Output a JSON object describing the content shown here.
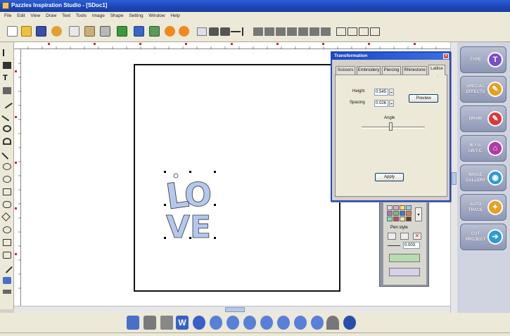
{
  "titlebar": {
    "title": "Pazzles Inspiration Studio - [SDoc1]"
  },
  "menu": [
    "File",
    "Edit",
    "View",
    "Draw",
    "Text",
    "Tools",
    "Image",
    "Shape",
    "Setting",
    "Window",
    "Help"
  ],
  "dialog": {
    "title": "Transformation",
    "tabs": [
      "Scissors",
      "Embroidery",
      "Piercing",
      "Rhinestone",
      "Lattice"
    ],
    "selected_tab": "Lattice",
    "height_label": "Height",
    "height_value": "0.545",
    "spacing_label": "Spacing",
    "spacing_value": "0.026",
    "angle_label": "Angle",
    "angle_slider_fraction": 0.45,
    "preview_label": "Preview",
    "apply_label": "Apply"
  },
  "side_buttons": [
    {
      "label": "TYPE",
      "icon": "type-icon"
    },
    {
      "label": "SPECIAL EFFECTS",
      "icon": "pencil-icon"
    },
    {
      "label": "DRAW",
      "icon": "draw-icon"
    },
    {
      "label": "W.Y.S. I.W.Y.C.",
      "icon": "house-icon"
    },
    {
      "label": "IMAGE GALLERY",
      "icon": "eye-icon"
    },
    {
      "label": "AUTO TRACE",
      "icon": "wand-icon"
    },
    {
      "label": "CUT PROJECT",
      "icon": "cut-icon"
    }
  ],
  "pen_panel": {
    "label": "Pen style",
    "width_value": "0.003"
  },
  "canvas": {
    "artwork_text": "LOVE",
    "artwork_color": "#b3c8ef"
  },
  "colors": {
    "titlebar": "#1c47b8",
    "dialog_border": "#2048c8",
    "side_panel": "#cfd4e0"
  }
}
